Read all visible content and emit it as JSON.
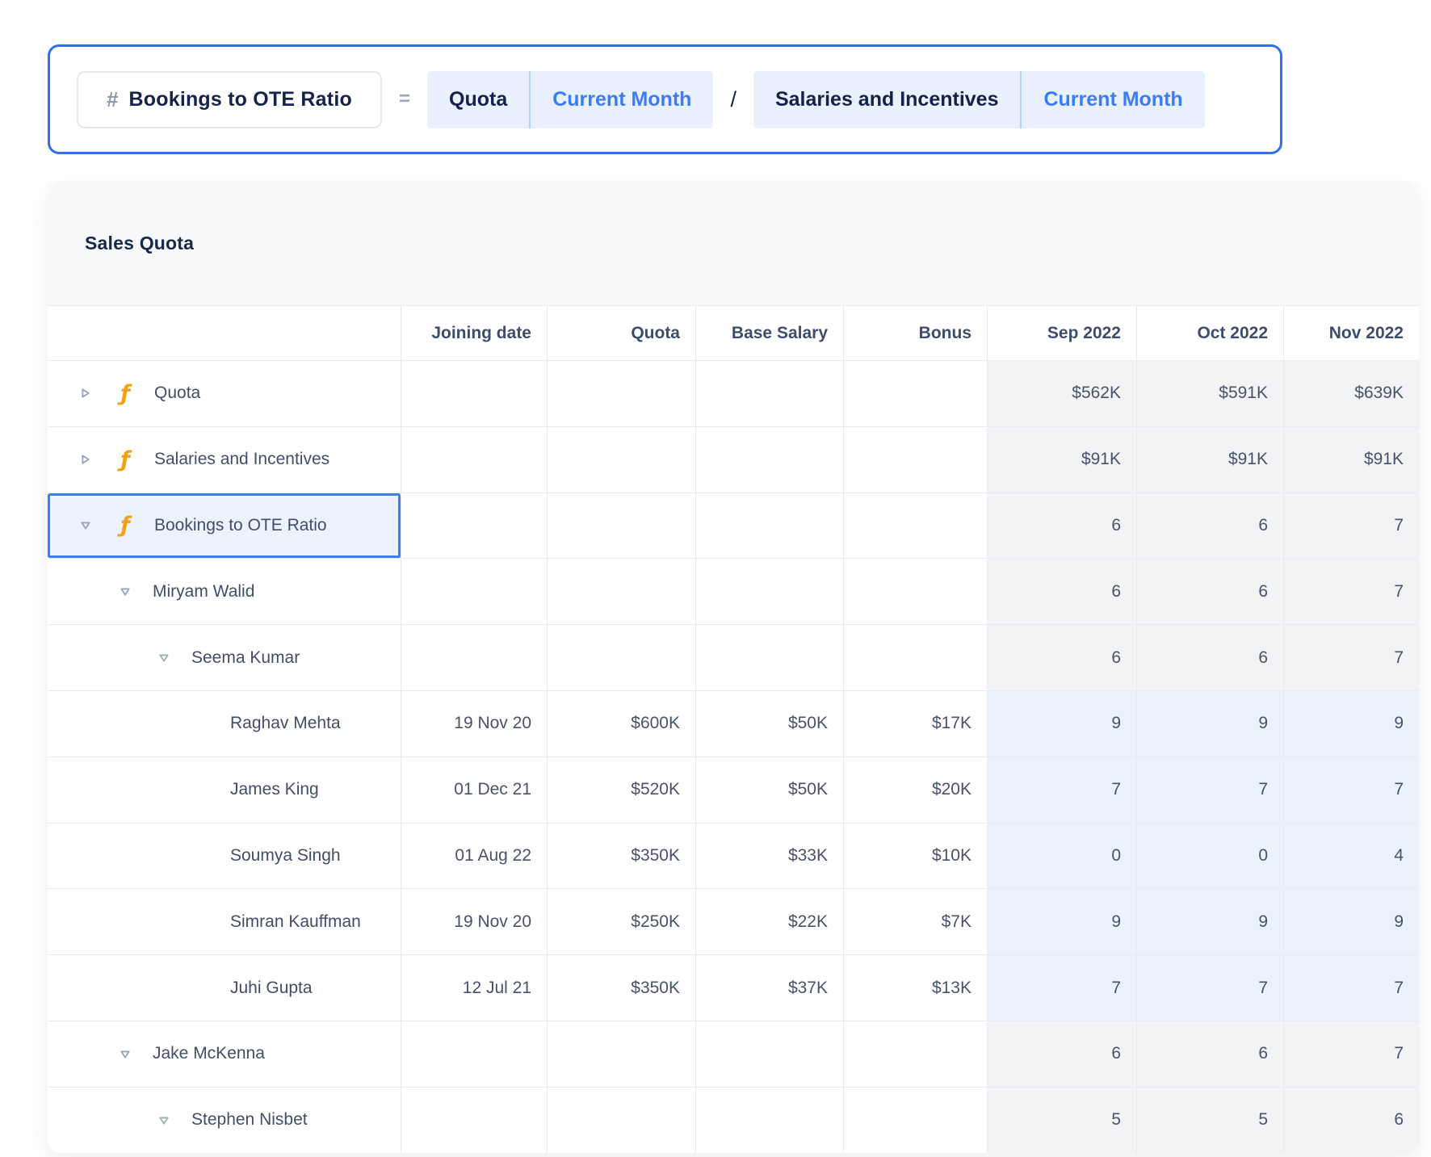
{
  "formula_bar": {
    "hash": "#",
    "metric_name": "Bookings to OTE Ratio",
    "equals": "=",
    "operator": "/",
    "left": {
      "name": "Quota",
      "modifier": "Current Month"
    },
    "right": {
      "name": "Salaries and Incentives",
      "modifier": "Current Month"
    }
  },
  "card": {
    "title": "Sales Quota",
    "columns": [
      "Joining date",
      "Quota",
      "Base Salary",
      "Bonus",
      "Sep 2022",
      "Oct 2022",
      "Nov 2022"
    ],
    "rows": [
      {
        "name": "Quota",
        "type": "formula",
        "level": 0,
        "expanded": false,
        "sep": "$562K",
        "oct": "$591K",
        "nov": "$639K"
      },
      {
        "name": "Salaries and Incentives",
        "type": "formula",
        "level": 0,
        "expanded": false,
        "sep": "$91K",
        "oct": "$91K",
        "nov": "$91K"
      },
      {
        "name": "Bookings to OTE Ratio",
        "type": "formula",
        "level": 0,
        "expanded": true,
        "selected": true,
        "sep": "6",
        "oct": "6",
        "nov": "7"
      },
      {
        "name": "Miryam Walid",
        "type": "group",
        "level": 1,
        "expanded": true,
        "sep": "6",
        "oct": "6",
        "nov": "7"
      },
      {
        "name": "Seema Kumar",
        "type": "group",
        "level": 2,
        "expanded": true,
        "sep": "6",
        "oct": "6",
        "nov": "7"
      },
      {
        "name": "Raghav Mehta",
        "type": "leaf",
        "level": 3,
        "joining_date": "19 Nov 20",
        "quota": "$600K",
        "base_salary": "$50K",
        "bonus": "$17K",
        "sep": "9",
        "oct": "9",
        "nov": "9"
      },
      {
        "name": "James King",
        "type": "leaf",
        "level": 3,
        "joining_date": "01 Dec 21",
        "quota": "$520K",
        "base_salary": "$50K",
        "bonus": "$20K",
        "sep": "7",
        "oct": "7",
        "nov": "7"
      },
      {
        "name": "Soumya Singh",
        "type": "leaf",
        "level": 3,
        "joining_date": "01 Aug 22",
        "quota": "$350K",
        "base_salary": "$33K",
        "bonus": "$10K",
        "sep": "0",
        "oct": "0",
        "nov": "4"
      },
      {
        "name": "Simran Kauffman",
        "type": "leaf",
        "level": 3,
        "joining_date": "19 Nov 20",
        "quota": "$250K",
        "base_salary": "$22K",
        "bonus": "$7K",
        "sep": "9",
        "oct": "9",
        "nov": "9"
      },
      {
        "name": "Juhi Gupta",
        "type": "leaf",
        "level": 3,
        "joining_date": "12 Jul 21",
        "quota": "$350K",
        "base_salary": "$37K",
        "bonus": "$13K",
        "sep": "7",
        "oct": "7",
        "nov": "7"
      },
      {
        "name": "Jake McKenna",
        "type": "group",
        "level": 1,
        "expanded": true,
        "sep": "6",
        "oct": "6",
        "nov": "7"
      },
      {
        "name": "Stephen Nisbet",
        "type": "group",
        "level": 2,
        "expanded": true,
        "sep": "5",
        "oct": "5",
        "nov": "6"
      }
    ]
  },
  "colors": {
    "accent_blue": "#3e7cf7",
    "formula_bar_border": "#316ff1",
    "dark_navy_text": "#15234a",
    "table_text": "#47536d",
    "formula_icon_orange": "#f2a015",
    "chip_background": "#e9f1fe",
    "aggregate_cell_background": "#f2f3f5",
    "leaf_cell_background": "#eaf2fc",
    "selected_row_background": "#ecf3fe",
    "gridline": "#e9ebf0",
    "card_header_background": "#f7f8fa"
  }
}
